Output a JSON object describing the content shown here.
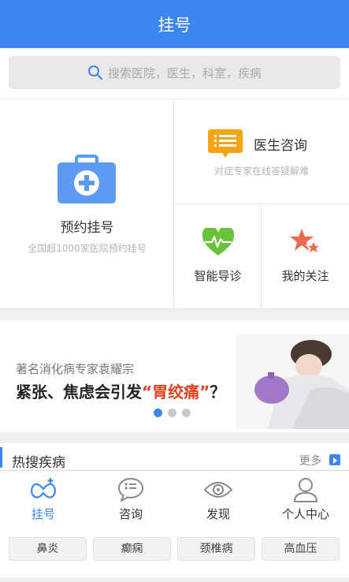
{
  "header": {
    "title": "挂号"
  },
  "search": {
    "placeholder": "搜索医院，医生，科室，疾病",
    "icon": "search-icon"
  },
  "grid": {
    "appointment": {
      "title": "预约挂号",
      "subtitle": "全国超1000家医院预约挂号",
      "icon": "medical-kit-icon"
    },
    "consult": {
      "title": "医生咨询",
      "subtitle": "对症专家在线答疑解难",
      "icon": "chat-list-icon"
    },
    "guide": {
      "title": "智能导诊",
      "icon": "heart-pulse-icon"
    },
    "follow": {
      "title": "我的关注",
      "icon": "stars-icon"
    }
  },
  "banner": {
    "line1": "著名消化病专家袁耀宗",
    "line2_prefix": "紧张、焦虑会引发",
    "line2_highlight": "“胃绞痛”",
    "line2_suffix": "？",
    "dots": 3,
    "active_dot": 0
  },
  "hot": {
    "title": "热搜疾病",
    "more": "更多"
  },
  "tabs": [
    {
      "label": "挂号",
      "icon": "register-icon",
      "active": true
    },
    {
      "label": "咨询",
      "icon": "chat-bubble-icon",
      "active": false
    },
    {
      "label": "发现",
      "icon": "eye-icon",
      "active": false
    },
    {
      "label": "个人中心",
      "icon": "person-icon",
      "active": false
    }
  ],
  "tags": [
    "鼻炎",
    "癫痫",
    "颈椎病",
    "高血压"
  ],
  "colors": {
    "accent": "#3d86f0",
    "orange": "#f5a514",
    "green": "#69c23a",
    "red": "#e1431f"
  }
}
